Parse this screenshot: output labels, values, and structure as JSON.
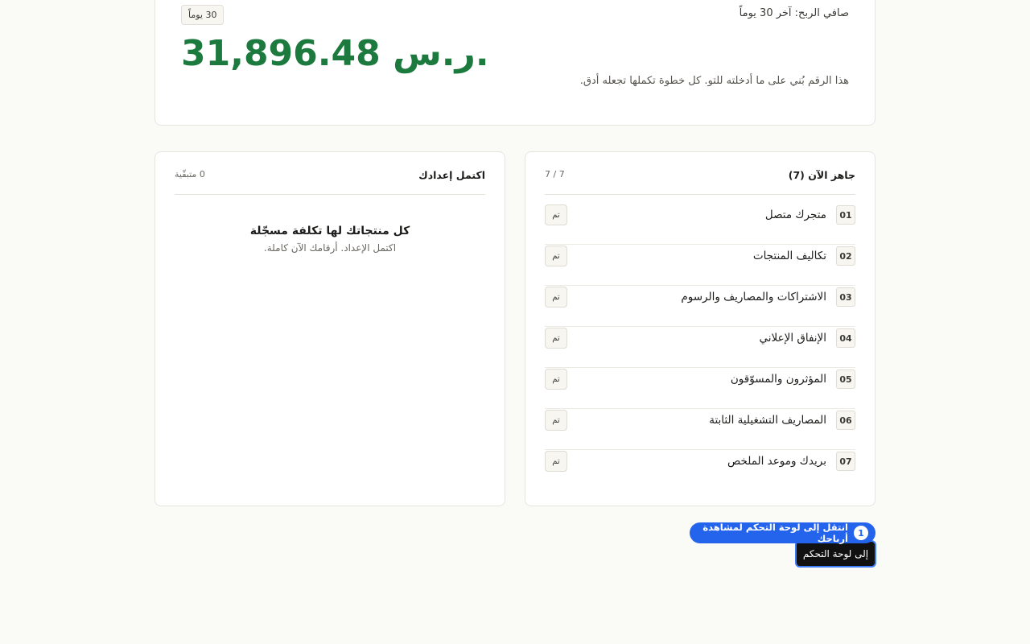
{
  "summary": {
    "label": "صافي الربح: آخر 30 يوماً",
    "period_chip": "30 يوماً",
    "value": "31,896.48 ر.س.",
    "note": "هذا الرقم بُني على ما أدخلته للتو. كل خطوة تكملها تجعله أدق."
  },
  "steps": {
    "title": "جاهز الآن (7)",
    "progress": "7 / 7",
    "items": [
      {
        "num": "01",
        "label": "متجرك متصل",
        "status": "تم"
      },
      {
        "num": "02",
        "label": "تكاليف المنتجات",
        "status": "تم"
      },
      {
        "num": "03",
        "label": "الاشتراكات والمصاريف والرسوم",
        "status": "تم"
      },
      {
        "num": "04",
        "label": "الإنفاق الإعلاني",
        "status": "تم"
      },
      {
        "num": "05",
        "label": "المؤثرون والمسوّقون",
        "status": "تم"
      },
      {
        "num": "06",
        "label": "المصاريف التشغيلية الثابتة",
        "status": "تم"
      },
      {
        "num": "07",
        "label": "بريدك وموعد الملخص",
        "status": "تم"
      }
    ]
  },
  "setup": {
    "title": "اكتمل إعدادك",
    "remaining": "0 متبقّية",
    "empty_title": "كل منتجاتك لها تكلفة مسجّلة",
    "empty_sub": "اكتمل الإعداد. أرقامك الآن كاملة."
  },
  "tour": {
    "step": "1",
    "text": "انتقل إلى لوحة التحكم لمشاهدة أرباحك"
  },
  "dashboard_button": {
    "label": "إلى لوحة التحكم"
  },
  "colors": {
    "profit": "#1d7a3e",
    "tour_accent": "#2463eb",
    "button_bg": "#111111"
  }
}
